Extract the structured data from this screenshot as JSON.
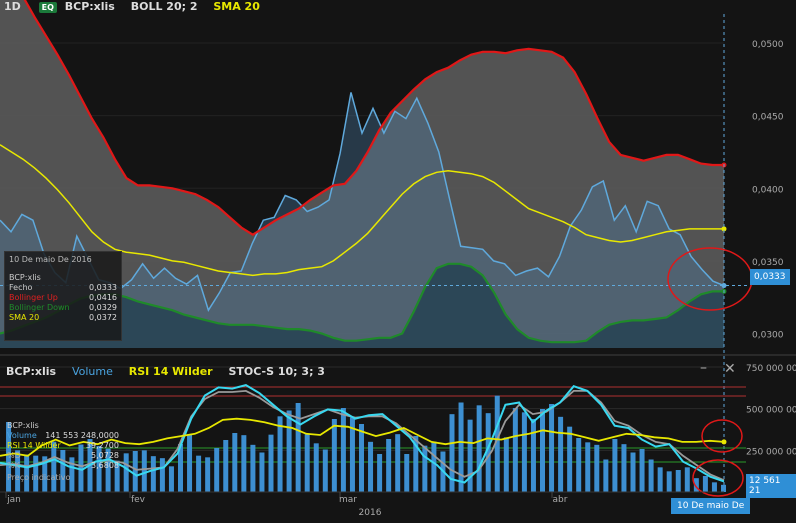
{
  "header": {
    "period": "1D",
    "eq_badge": "EQ",
    "symbol": "BCP:xlis",
    "indicator1": "BOLL 20; 2",
    "indicator2": "SMA 20"
  },
  "tooltip": {
    "date": "10 De maio De 2016",
    "symbol": "BCP:xlis",
    "rows": [
      {
        "label": "Fecho",
        "value": "0,0333",
        "color": "#cccccc"
      },
      {
        "label": "Bollinger Up",
        "value": "0,0416",
        "color": "#e02020"
      },
      {
        "label": "Bollinger Down",
        "value": "0,0329",
        "color": "#1f8a2a"
      },
      {
        "label": "SMA 20",
        "value": "0,0372",
        "color": "#e8e800"
      }
    ]
  },
  "price_tag": "0,0333",
  "lower_header": {
    "symbol": "BCP:xlis",
    "ind1": "Volume",
    "ind2": "RSI 14 Wilder",
    "ind3": "STOC-S 10; 3; 3"
  },
  "lower_legend": {
    "symbol": "BCP:xlis",
    "rows": [
      {
        "label": "Volume",
        "value": "141 553 248,0000",
        "color": "#4aa3df"
      },
      {
        "label": "RSI 14 Wilder",
        "value": "39,2700",
        "color": "#e8e800"
      },
      {
        "label": "%D",
        "value": "5,0728",
        "color": "#aaaaaa"
      },
      {
        "label": "%K",
        "value": "3,6808",
        "color": "#aaaaaa"
      }
    ],
    "note": "Preço indicativo"
  },
  "volume_tag": "12 561 21",
  "date_tag": "10 De maio De",
  "controls": {
    "minimize": "–",
    "close": "✕"
  },
  "colors": {
    "bg": "#141414",
    "band_fill": "#5e5e5e",
    "boll_up": "#e01818",
    "boll_down": "#1f8a2a",
    "sma": "#e8e800",
    "close": "#5fa9dc",
    "volume": "#3d8fd1",
    "rsi": "#e8e800",
    "stoch_k": "#38d8f0",
    "stoch_d": "#9a9a9a",
    "highlight": "#e01818"
  },
  "chart_data": [
    {
      "type": "line",
      "title": "BCP:xlis BOLL 20; 2 SMA 20",
      "x_range": [
        "2016-01-01",
        "2016-05-10"
      ],
      "x_tick_labels": [
        "jan",
        "fev",
        "mar",
        "abr"
      ],
      "year_label": "2016",
      "y_tick_labels": [
        "0,0500",
        "0,0450",
        "0,0400",
        "0,0350",
        "0,0300"
      ],
      "ylim": [
        0.029,
        0.052
      ],
      "series": [
        {
          "name": "Bollinger Up",
          "values": [
            0.0555,
            0.0545,
            0.0532,
            0.0518,
            0.0505,
            0.0492,
            0.0478,
            0.0463,
            0.0448,
            0.0435,
            0.042,
            0.0407,
            0.0402,
            0.0402,
            0.0401,
            0.04,
            0.0398,
            0.0396,
            0.0392,
            0.0387,
            0.038,
            0.0373,
            0.0368,
            0.0373,
            0.0378,
            0.0382,
            0.0386,
            0.0392,
            0.0397,
            0.0402,
            0.0403,
            0.0412,
            0.0425,
            0.044,
            0.0452,
            0.046,
            0.0468,
            0.0475,
            0.048,
            0.0483,
            0.0488,
            0.0492,
            0.0494,
            0.0494,
            0.0493,
            0.0495,
            0.0496,
            0.0495,
            0.0494,
            0.049,
            0.048,
            0.0465,
            0.0448,
            0.0432,
            0.0423,
            0.0421,
            0.0419,
            0.0421,
            0.0423,
            0.0423,
            0.042,
            0.0417,
            0.0416,
            0.0416
          ]
        },
        {
          "name": "SMA 20",
          "values": [
            0.043,
            0.0425,
            0.042,
            0.0414,
            0.0407,
            0.0399,
            0.039,
            0.038,
            0.037,
            0.0363,
            0.0358,
            0.0356,
            0.0355,
            0.0354,
            0.0352,
            0.035,
            0.0349,
            0.0347,
            0.0345,
            0.0343,
            0.0342,
            0.0341,
            0.034,
            0.0341,
            0.0341,
            0.0342,
            0.0344,
            0.0345,
            0.0346,
            0.035,
            0.0356,
            0.0362,
            0.0369,
            0.0378,
            0.0387,
            0.0396,
            0.0403,
            0.0408,
            0.0411,
            0.0412,
            0.0411,
            0.041,
            0.0408,
            0.0404,
            0.0398,
            0.0392,
            0.0386,
            0.0383,
            0.038,
            0.0377,
            0.0373,
            0.0368,
            0.0366,
            0.0364,
            0.0363,
            0.0364,
            0.0366,
            0.0368,
            0.037,
            0.0371,
            0.0372,
            0.0372,
            0.0372,
            0.0372
          ]
        },
        {
          "name": "Bollinger Down",
          "values": [
            0.03,
            0.0302,
            0.0305,
            0.0308,
            0.0311,
            0.0315,
            0.032,
            0.0324,
            0.0326,
            0.0327,
            0.0327,
            0.0325,
            0.0322,
            0.032,
            0.0318,
            0.0316,
            0.0313,
            0.0311,
            0.0309,
            0.0307,
            0.0306,
            0.0306,
            0.0306,
            0.0305,
            0.0304,
            0.0303,
            0.0303,
            0.0302,
            0.03,
            0.0297,
            0.0295,
            0.0295,
            0.0296,
            0.0297,
            0.0297,
            0.03,
            0.0315,
            0.0332,
            0.0345,
            0.0348,
            0.0348,
            0.0346,
            0.034,
            0.0328,
            0.0313,
            0.0303,
            0.0297,
            0.0295,
            0.0294,
            0.0294,
            0.0294,
            0.0295,
            0.0301,
            0.0306,
            0.0308,
            0.0309,
            0.0309,
            0.031,
            0.0311,
            0.0316,
            0.0322,
            0.0327,
            0.0329,
            0.0329
          ]
        },
        {
          "name": "Fecho",
          "values": [
            0.0378,
            0.037,
            0.0382,
            0.0378,
            0.0355,
            0.0342,
            0.0335,
            0.0367,
            0.0352,
            0.0337,
            0.0335,
            0.0331,
            0.0337,
            0.0348,
            0.0338,
            0.0345,
            0.0338,
            0.0334,
            0.034,
            0.0316,
            0.0328,
            0.0342,
            0.0343,
            0.0362,
            0.0378,
            0.038,
            0.0395,
            0.0392,
            0.0384,
            0.0387,
            0.0392,
            0.0424,
            0.0466,
            0.0438,
            0.0455,
            0.0438,
            0.0453,
            0.0448,
            0.0462,
            0.0445,
            0.0425,
            0.0392,
            0.036,
            0.0359,
            0.0358,
            0.035,
            0.0348,
            0.034,
            0.0343,
            0.0345,
            0.0339,
            0.0353,
            0.0374,
            0.0385,
            0.0401,
            0.0405,
            0.0378,
            0.0388,
            0.037,
            0.0391,
            0.0388,
            0.0372,
            0.0368,
            0.0353,
            0.0344,
            0.0336,
            0.0333
          ]
        }
      ]
    },
    {
      "type": "bar",
      "title": "BCP:xlis Volume RSI 14 Wilder STOC-S 10; 3; 3",
      "y_tick_labels": [
        "750 000 000",
        "500 000 000",
        "250 000 000"
      ],
      "ylim": [
        0,
        780000000
      ],
      "series": [
        {
          "name": "Volume",
          "values": [
            0,
            420,
            250,
            225,
            218,
            214,
            302,
            252,
            208,
            285,
            318,
            276,
            260,
            188,
            232,
            246,
            250,
            215,
            203,
            154,
            288,
            346,
            218,
            208,
            264,
            312,
            354,
            341,
            283,
            237,
            344,
            454,
            489,
            534,
            347,
            292,
            255,
            438,
            504,
            448,
            408,
            301,
            228,
            318,
            347,
            228,
            336,
            278,
            302,
            243,
            467,
            537,
            434,
            520,
            473,
            578,
            328,
            504,
            478,
            438,
            498,
            528,
            451,
            392,
            324,
            298,
            283,
            195,
            318,
            287,
            237,
            258,
            195,
            148,
            124,
            132,
            148,
            83,
            96,
            58,
            43
          ]
        },
        {
          "name": "RSI 14 Wilder",
          "values": [
            26,
            28,
            26,
            35,
            40,
            35,
            38,
            36,
            40,
            37,
            36,
            38,
            41,
            43,
            45,
            50,
            57,
            58,
            57,
            55,
            52,
            50,
            45,
            44,
            52,
            51,
            47,
            43,
            46,
            50,
            44,
            38,
            36,
            38,
            37,
            41,
            40,
            43,
            45,
            48,
            46,
            45,
            42,
            39,
            42,
            45,
            44,
            42,
            41,
            38,
            38,
            39,
            38
          ]
        },
        {
          "name": "%K",
          "values": [
            20,
            18,
            16,
            19,
            23,
            17,
            14,
            21,
            23,
            17,
            9,
            13,
            16,
            28,
            58,
            78,
            85,
            84,
            87,
            80,
            70,
            60,
            53,
            60,
            66,
            65,
            58,
            61,
            62,
            52,
            42,
            26,
            18,
            6,
            3,
            14,
            40,
            70,
            72,
            55,
            65,
            72,
            86,
            82,
            70,
            52,
            50,
            40,
            34,
            36,
            21,
            15,
            8,
            4
          ]
        },
        {
          "name": "%D",
          "values": [
            18,
            19,
            17,
            20,
            25,
            20,
            17,
            21,
            22,
            20,
            14,
            15,
            16,
            32,
            60,
            75,
            81,
            81,
            82,
            76,
            68,
            62,
            58,
            62,
            66,
            62,
            59,
            60,
            60,
            54,
            44,
            34,
            24,
            14,
            8,
            13,
            30,
            56,
            70,
            62,
            64,
            72,
            82,
            82,
            72,
            56,
            52,
            44,
            38,
            36,
            26,
            18,
            10,
            5
          ]
        }
      ]
    }
  ]
}
